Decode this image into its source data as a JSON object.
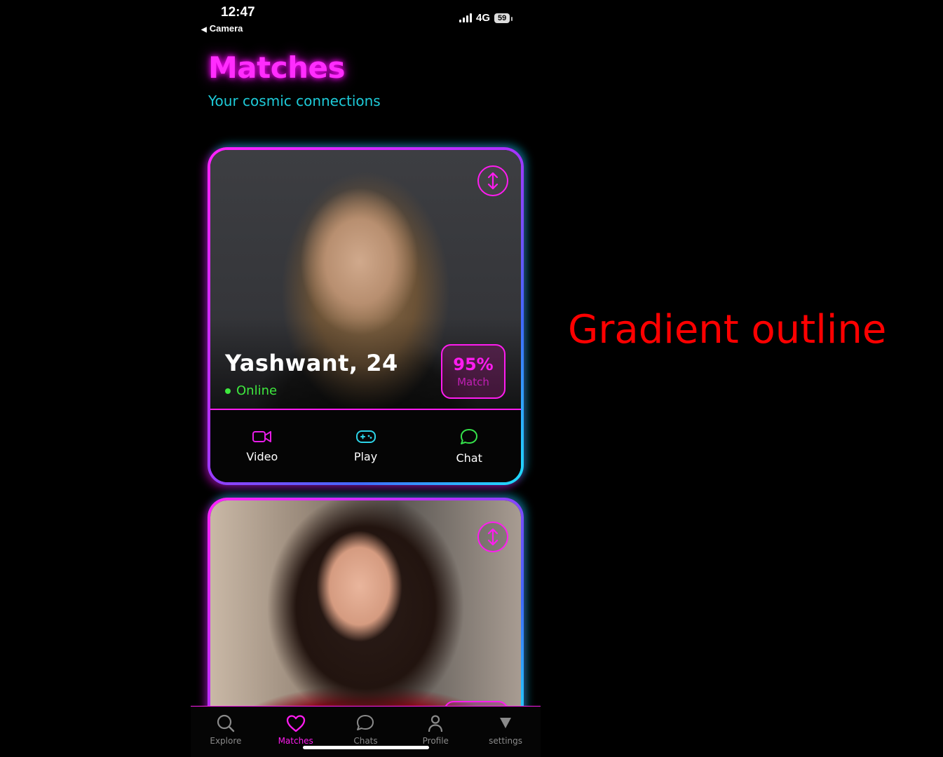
{
  "status_bar": {
    "time": "12:47",
    "back_label": "Camera",
    "network": "4G",
    "battery": "59"
  },
  "header": {
    "title": "Matches",
    "subtitle": "Your cosmic connections"
  },
  "cards": [
    {
      "name": "Yashwant, 24",
      "status": "Online",
      "match_percent": "95%",
      "match_label": "Match",
      "actions": [
        {
          "label": "Video",
          "icon": "video-camera-icon"
        },
        {
          "label": "Play",
          "icon": "gamepad-icon"
        },
        {
          "label": "Chat",
          "icon": "chat-bubble-icon"
        }
      ]
    },
    {}
  ],
  "tabbar": {
    "tabs": [
      {
        "label": "Explore",
        "icon": "search-icon"
      },
      {
        "label": "Matches",
        "icon": "heart-icon",
        "active": true
      },
      {
        "label": "Chats",
        "icon": "chat-icon"
      },
      {
        "label": "Profile",
        "icon": "person-icon"
      },
      {
        "label": "settings",
        "icon": "triangle-down-icon"
      }
    ]
  },
  "annotation": "Gradient outline",
  "colors": {
    "neon_pink": "#ff1cf0",
    "cyan": "#1ecbd9",
    "online_green": "#3ee83e",
    "annotation_red": "#ff0000"
  }
}
